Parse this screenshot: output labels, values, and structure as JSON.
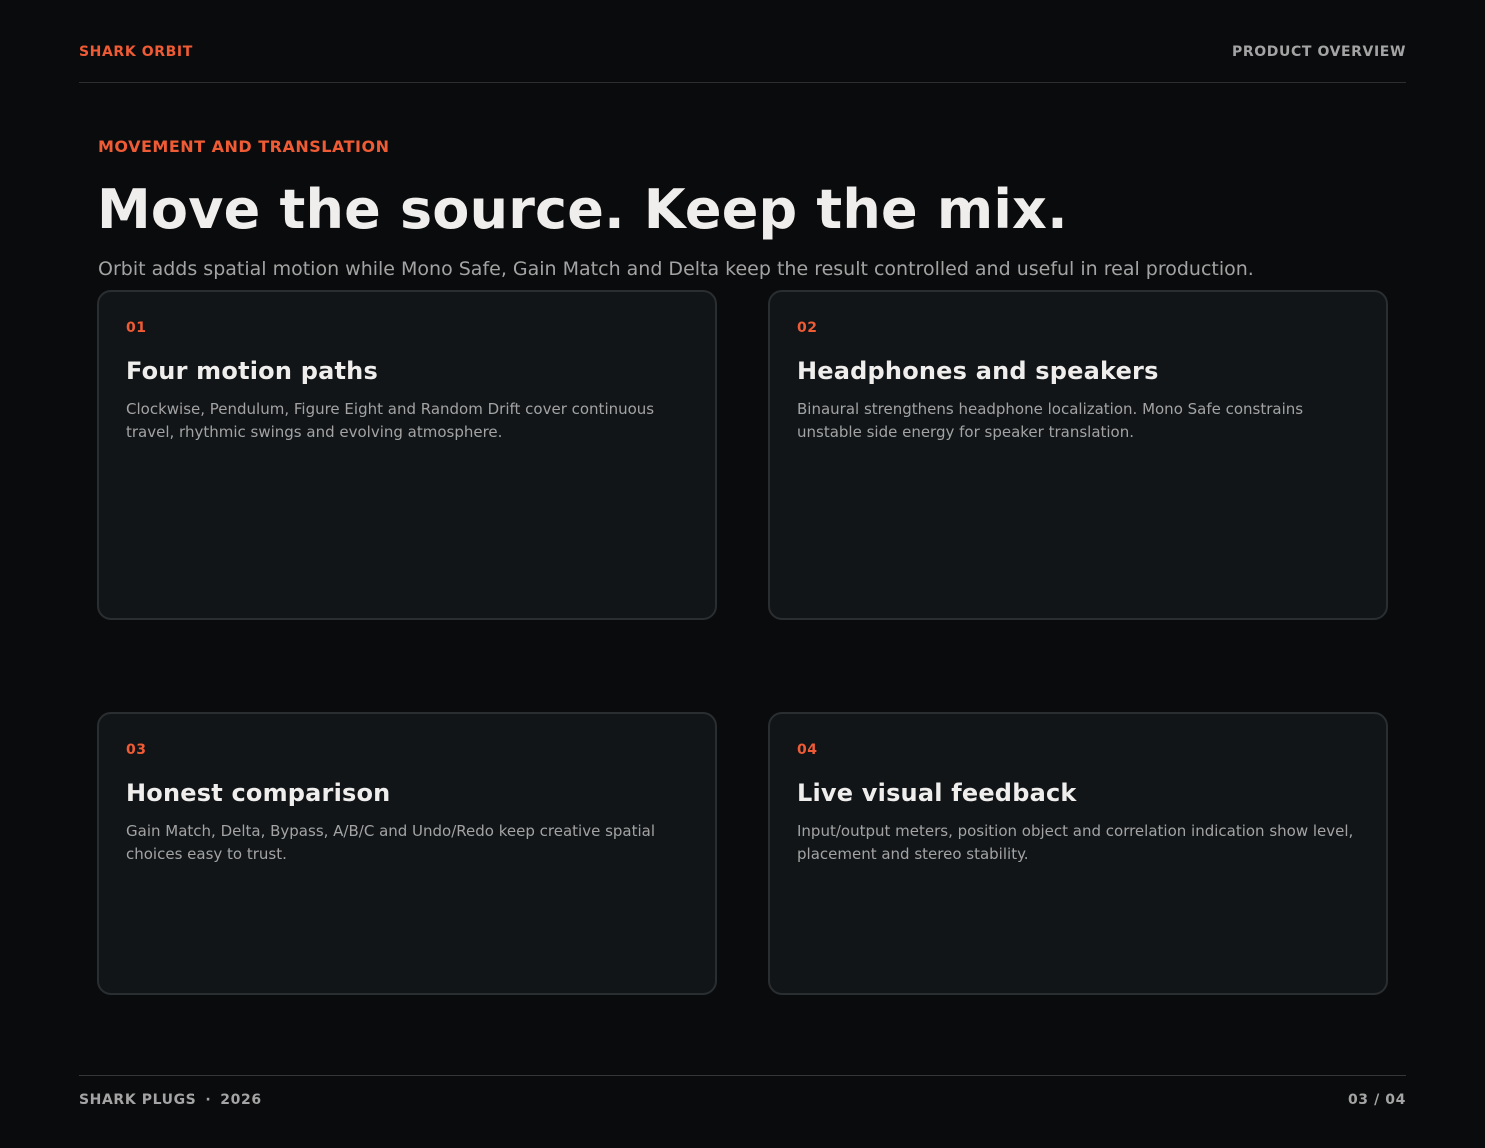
{
  "header": {
    "brand": "SHARK ORBIT",
    "doc_type": "PRODUCT OVERVIEW"
  },
  "hero": {
    "eyebrow": "MOVEMENT AND TRANSLATION",
    "headline": "Move the source. Keep the mix.",
    "subhead": "Orbit adds spatial motion while Mono Safe, Gain Match and Delta keep the result controlled and useful in real production."
  },
  "cards": [
    {
      "number": "01",
      "title": "Four motion paths",
      "description": "Clockwise, Pendulum, Figure Eight and Random Drift cover continuous travel, rhythmic swings and evolving atmosphere."
    },
    {
      "number": "02",
      "title": "Headphones and speakers",
      "description": "Binaural strengthens headphone localization. Mono Safe constrains unstable side energy for speaker translation."
    },
    {
      "number": "03",
      "title": "Honest comparison",
      "description": "Gain Match, Delta, Bypass, A/B/C and Undo/Redo keep creative spatial choices easy to trust."
    },
    {
      "number": "04",
      "title": "Live visual feedback",
      "description": "Input/output meters, position object and correlation indication show level, placement and stereo stability."
    }
  ],
  "footer": {
    "company": "SHARK PLUGS",
    "separator": "·",
    "year": "2026",
    "page_indicator": "03 / 04"
  },
  "colors": {
    "accent": "#ef5b35",
    "background": "#0a0b0c",
    "card_background": "#111518",
    "heading": "#f0eeec",
    "muted_text": "#a3a3a3"
  }
}
